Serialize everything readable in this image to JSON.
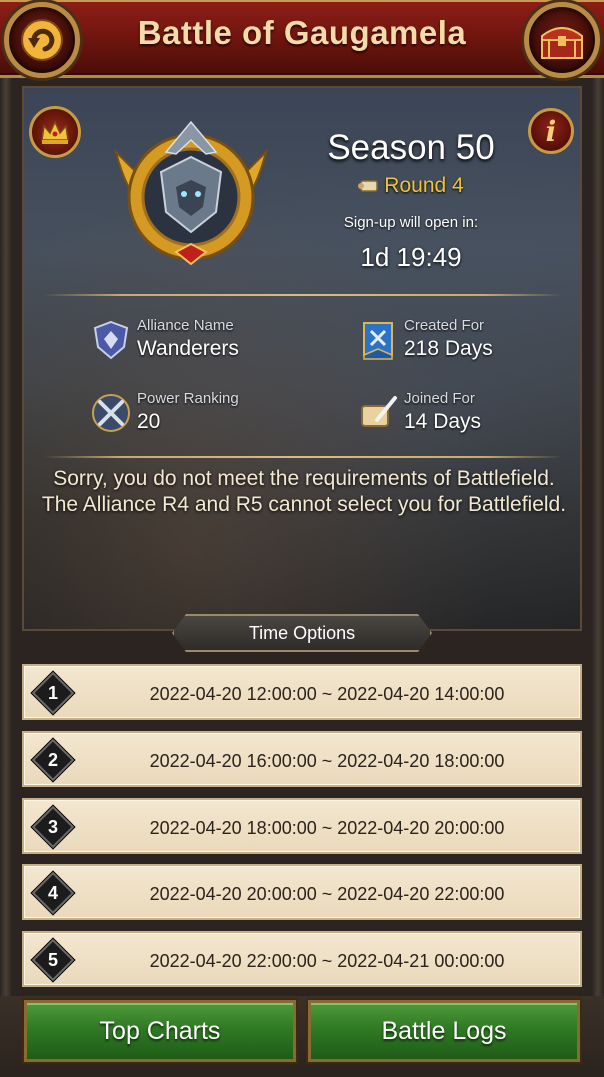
{
  "header": {
    "title": "Battle of Gaugamela",
    "back_icon": "back-arrow-icon",
    "chest_icon": "treasure-chest-icon"
  },
  "season": {
    "title": "Season 50",
    "round": "Round 4",
    "signup_label": "Sign-up will open in:",
    "countdown": "1d 19:49"
  },
  "stats": {
    "alliance_name_label": "Alliance Name",
    "alliance_name": "Wanderers",
    "created_for_label": "Created For",
    "created_for": "218 Days",
    "power_ranking_label": "Power Ranking",
    "power_ranking": "20",
    "joined_for_label": "Joined For",
    "joined_for": "14 Days"
  },
  "notice": "Sorry, you do not meet the requirements of Battlefield. The Alliance R4 and R5 cannot select you for Battlefield.",
  "time_options": {
    "label": "Time Options",
    "items": [
      {
        "num": "1",
        "range": "2022-04-20 12:00:00 ~ 2022-04-20 14:00:00"
      },
      {
        "num": "2",
        "range": "2022-04-20 16:00:00 ~ 2022-04-20 18:00:00"
      },
      {
        "num": "3",
        "range": "2022-04-20 18:00:00 ~ 2022-04-20 20:00:00"
      },
      {
        "num": "4",
        "range": "2022-04-20 20:00:00 ~ 2022-04-20 22:00:00"
      },
      {
        "num": "5",
        "range": "2022-04-20 22:00:00 ~ 2022-04-21 00:00:00"
      }
    ]
  },
  "buttons": {
    "top_charts": "Top Charts",
    "battle_logs": "Battle Logs"
  },
  "colors": {
    "header_red": "#8e1f16",
    "gold_text": "#f0c23a",
    "button_green": "#2f7a24",
    "option_bg": "#f3e7d0"
  }
}
